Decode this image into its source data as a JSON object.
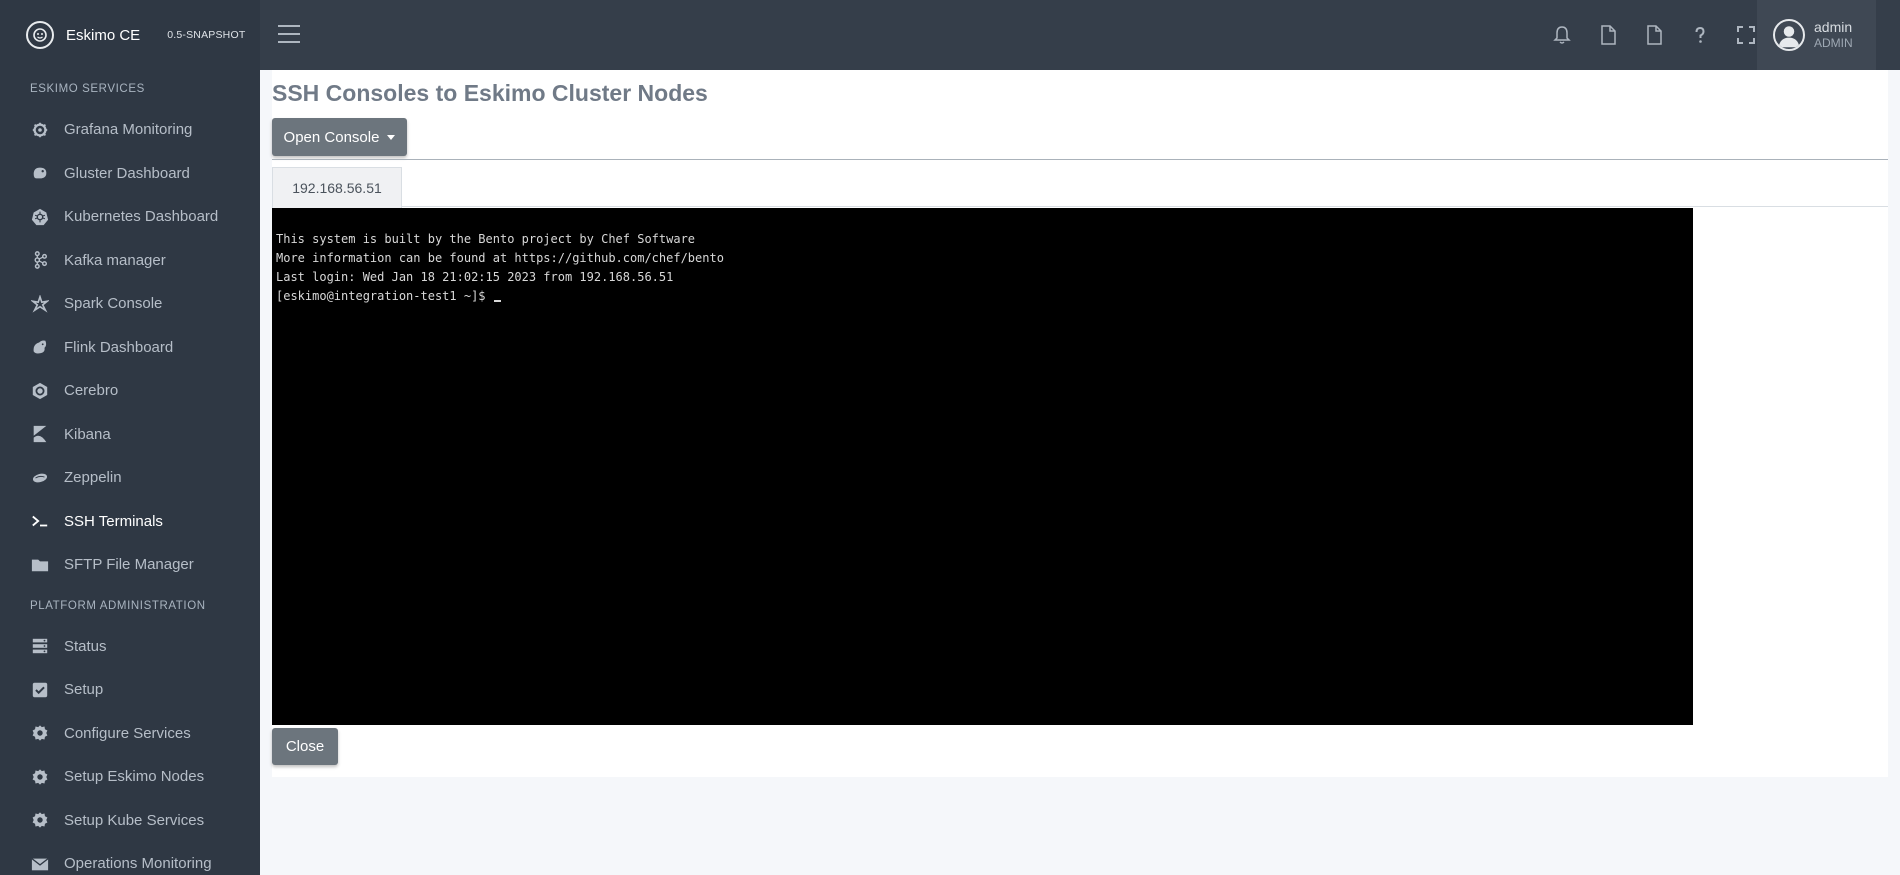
{
  "brand": {
    "name": "Eskimo CE",
    "version": "0.5-SNAPSHOT"
  },
  "sidebar": {
    "sections": [
      {
        "title": "ESKIMO SERVICES",
        "items": [
          {
            "label": "Grafana Monitoring",
            "icon": "grafana-icon"
          },
          {
            "label": "Gluster Dashboard",
            "icon": "gluster-icon"
          },
          {
            "label": "Kubernetes Dashboard",
            "icon": "kubernetes-icon"
          },
          {
            "label": "Kafka manager",
            "icon": "kafka-icon"
          },
          {
            "label": "Spark Console",
            "icon": "spark-icon"
          },
          {
            "label": "Flink Dashboard",
            "icon": "flink-icon"
          },
          {
            "label": "Cerebro",
            "icon": "cerebro-icon"
          },
          {
            "label": "Kibana",
            "icon": "kibana-icon"
          },
          {
            "label": "Zeppelin",
            "icon": "zeppelin-icon"
          },
          {
            "label": "SSH Terminals",
            "icon": "terminal-icon",
            "active": true
          },
          {
            "label": "SFTP File Manager",
            "icon": "folder-icon"
          }
        ]
      },
      {
        "title": "PLATFORM ADMINISTRATION",
        "items": [
          {
            "label": "Status",
            "icon": "server-icon"
          },
          {
            "label": "Setup",
            "icon": "checkbox-icon"
          },
          {
            "label": "Configure Services",
            "icon": "gear-icon"
          },
          {
            "label": "Setup Eskimo Nodes",
            "icon": "gear-icon"
          },
          {
            "label": "Setup Kube Services",
            "icon": "gear-icon"
          },
          {
            "label": "Operations Monitoring",
            "icon": "envelope-icon"
          }
        ]
      }
    ]
  },
  "topbar": {
    "icons": [
      "bell-icon",
      "file-icon",
      "file-icon",
      "question-icon",
      "fullscreen-icon"
    ],
    "user": {
      "name": "admin",
      "role": "ADMIN"
    }
  },
  "main": {
    "title": "SSH Consoles to Eskimo Cluster Nodes",
    "open_console_label": "Open Console",
    "tabs": [
      {
        "label": "192.168.56.51"
      }
    ],
    "terminal": {
      "lines": [
        "This system is built by the Bento project by Chef Software",
        "More information can be found at https://github.com/chef/bento",
        "Last login: Wed Jan 18 21:02:15 2023 from 192.168.56.51",
        "[eskimo@integration-test1 ~]$"
      ]
    },
    "close_label": "Close"
  }
}
